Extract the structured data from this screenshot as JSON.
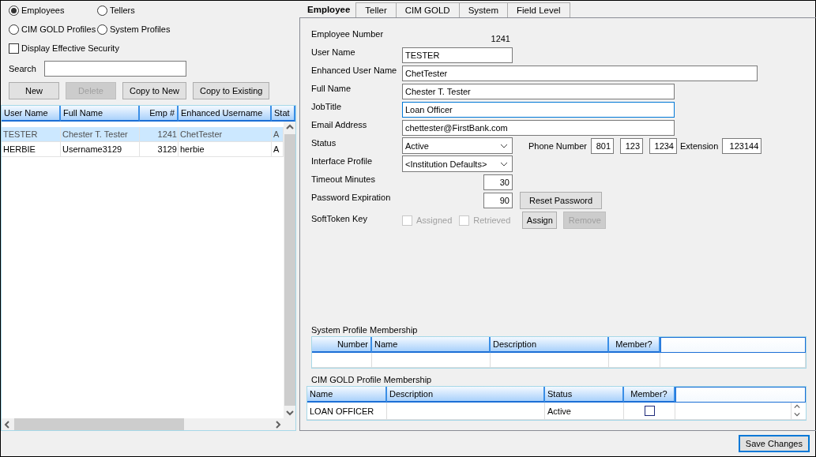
{
  "view_options": [
    {
      "label": "Employees",
      "selected": true
    },
    {
      "label": "Tellers",
      "selected": false
    },
    {
      "label": "CIM GOLD Profiles",
      "selected": false
    },
    {
      "label": "System Profiles",
      "selected": false
    }
  ],
  "display_effective_security": {
    "label": "Display Effective Security",
    "checked": false
  },
  "search": {
    "label": "Search"
  },
  "list_buttons": [
    {
      "label": "New",
      "disabled": false
    },
    {
      "label": "Delete",
      "disabled": true
    },
    {
      "label": "Copy to New",
      "disabled": false
    },
    {
      "label": "Copy to Existing",
      "disabled": false
    }
  ],
  "employees_table": {
    "columns": [
      {
        "label": "User Name",
        "kind": "text"
      },
      {
        "label": "Full Name",
        "kind": "text"
      },
      {
        "label": "Emp #",
        "kind": "number"
      },
      {
        "label": "Enhanced Username",
        "kind": "text"
      },
      {
        "label": "Stat",
        "kind": "text"
      }
    ],
    "rows": [
      {
        "selected": true,
        "cells": [
          "TESTER",
          "Chester T. Tester",
          "1241",
          "ChetTester",
          "A"
        ]
      },
      {
        "selected": false,
        "cells": [
          "HERBIE",
          "Username3129",
          "3129",
          "herbie",
          "A"
        ]
      }
    ]
  },
  "tabs": [
    {
      "label": "Employee",
      "selected": true
    },
    {
      "label": "Teller",
      "selected": false
    },
    {
      "label": "CIM GOLD",
      "selected": false
    },
    {
      "label": "System",
      "selected": false
    },
    {
      "label": "Field Level",
      "selected": false
    }
  ],
  "form": {
    "employee_number": {
      "label": "Employee Number",
      "value": "1241"
    },
    "user_name": {
      "label": "User Name",
      "value": "TESTER",
      "focused": false
    },
    "enhanced_user_name": {
      "label": "Enhanced User Name",
      "value": "ChetTester",
      "focused": false
    },
    "full_name": {
      "label": "Full Name",
      "value": "Chester T. Tester",
      "focused": false
    },
    "job_title": {
      "label": "JobTitle",
      "value": "Loan Officer",
      "focused": true
    },
    "email_address": {
      "label": "Email Address",
      "value": "chettester@FirstBank.com",
      "focused": false
    },
    "status": {
      "label": "Status",
      "value": "Active"
    },
    "phone_number": {
      "label": "Phone Number",
      "parts": [
        "801",
        "123",
        "1234"
      ]
    },
    "extension": {
      "label": "Extension",
      "value": "123144"
    },
    "interface_profile": {
      "label": "Interface Profile",
      "value": "<Institution Defaults>"
    },
    "timeout_minutes": {
      "label": "Timeout Minutes",
      "value": "30"
    },
    "password_expiration": {
      "label": "Password Expiration",
      "value": "90"
    },
    "reset_password_button": {
      "label": "Reset Password",
      "disabled": false
    },
    "soft_token_key": {
      "label": "SoftToken Key",
      "options": [
        {
          "label": "Assigned",
          "checked": false,
          "disabled": true
        },
        {
          "label": "Retrieved",
          "checked": false,
          "disabled": true
        }
      ],
      "buttons": [
        {
          "label": "Assign",
          "disabled": false
        },
        {
          "label": "Remove",
          "disabled": true
        }
      ]
    }
  },
  "system_profile_membership": {
    "title": "System Profile Membership",
    "columns": [
      {
        "label": "Number",
        "kind": "number"
      },
      {
        "label": "Name",
        "kind": "text"
      },
      {
        "label": "Description",
        "kind": "text"
      },
      {
        "label": "Member?",
        "kind": "check"
      },
      {
        "kind": "filler"
      }
    ]
  },
  "cim_gold_profile_membership": {
    "title": "CIM GOLD Profile Membership",
    "columns": [
      {
        "label": "Name",
        "kind": "text"
      },
      {
        "label": "Description",
        "kind": "text"
      },
      {
        "label": "Status",
        "kind": "text"
      },
      {
        "label": "Member?",
        "kind": "check"
      },
      {
        "kind": "filler"
      }
    ],
    "rows": [
      {
        "name": "LOAN OFFICER",
        "status": "Active",
        "member": false
      }
    ]
  },
  "save_button": {
    "label": "Save Changes"
  }
}
